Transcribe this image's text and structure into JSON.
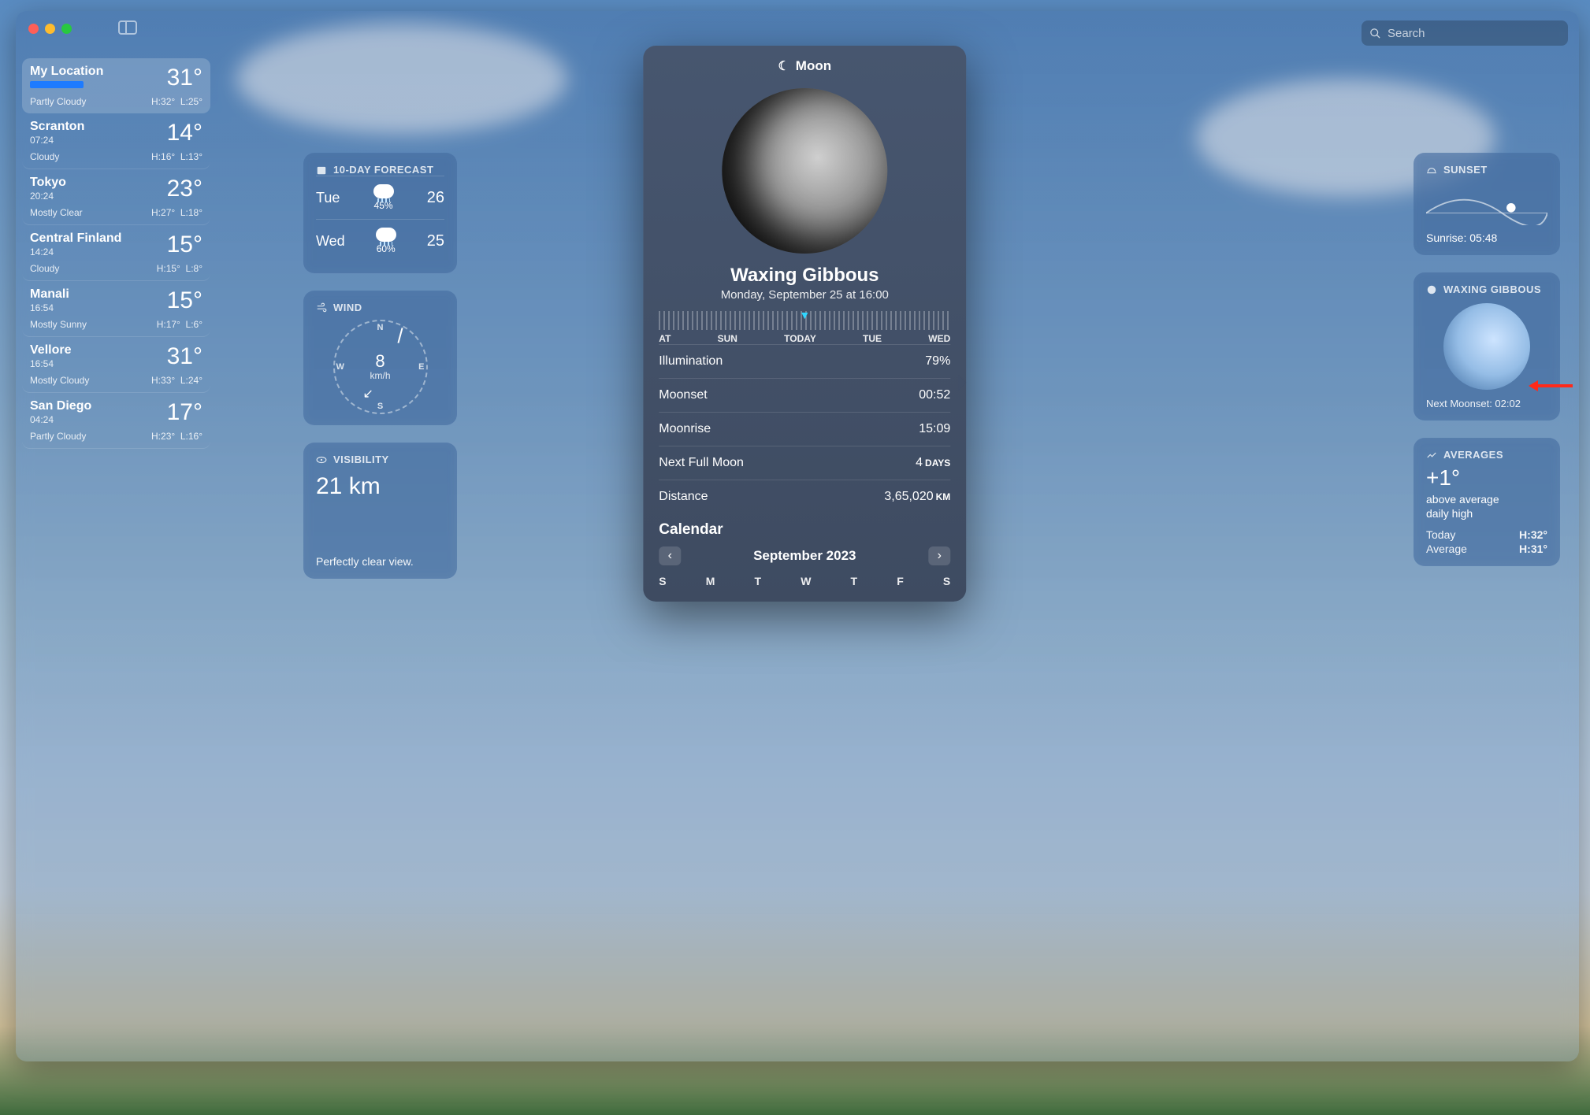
{
  "search": {
    "placeholder": "Search"
  },
  "sidebar": {
    "items": [
      {
        "name": "My Location",
        "time": "",
        "temp": "31°",
        "cond": "Partly Cloudy",
        "hi": "H:32°",
        "lo": "L:25°",
        "selected": true,
        "bluebar": true
      },
      {
        "name": "Scranton",
        "time": "07:24",
        "temp": "14°",
        "cond": "Cloudy",
        "hi": "H:16°",
        "lo": "L:13°"
      },
      {
        "name": "Tokyo",
        "time": "20:24",
        "temp": "23°",
        "cond": "Mostly Clear",
        "hi": "H:27°",
        "lo": "L:18°"
      },
      {
        "name": "Central Finland",
        "time": "14:24",
        "temp": "15°",
        "cond": "Cloudy",
        "hi": "H:15°",
        "lo": "L:8°"
      },
      {
        "name": "Manali",
        "time": "16:54",
        "temp": "15°",
        "cond": "Mostly Sunny",
        "hi": "H:17°",
        "lo": "L:6°"
      },
      {
        "name": "Vellore",
        "time": "16:54",
        "temp": "31°",
        "cond": "Mostly Cloudy",
        "hi": "H:33°",
        "lo": "L:24°"
      },
      {
        "name": "San Diego",
        "time": "04:24",
        "temp": "17°",
        "cond": "Partly Cloudy",
        "hi": "H:23°",
        "lo": "L:16°"
      }
    ]
  },
  "forecast": {
    "title": "10-DAY FORECAST",
    "rows": [
      {
        "day": "Tue",
        "pct": "45%",
        "hi": "26"
      },
      {
        "day": "Wed",
        "pct": "60%",
        "hi": "25"
      }
    ]
  },
  "wind": {
    "title": "WIND",
    "speed": "8",
    "unit": "km/h",
    "dirs": {
      "n": "N",
      "s": "S",
      "e": "E",
      "w": "W"
    }
  },
  "visibility": {
    "title": "VISIBILITY",
    "value": "21 km",
    "desc": "Perfectly clear view."
  },
  "sunset": {
    "title": "SUNSET",
    "sunrise": "Sunrise: 05:48"
  },
  "gibbous_card": {
    "title": "WAXING GIBBOUS",
    "next": "Next Moonset: 02:02"
  },
  "averages": {
    "title": "AVERAGES",
    "delta": "+1°",
    "sub1": "above average",
    "sub2": "daily high",
    "today_label": "Today",
    "today_val": "H:32°",
    "avg_label": "Average",
    "avg_val": "H:31°"
  },
  "moon": {
    "header": "Moon",
    "phase": "Waxing Gibbous",
    "date": "Monday, September 25 at 16:00",
    "timeline": {
      "labels": [
        "AT",
        "SUN",
        "TODAY",
        "TUE",
        "WED"
      ],
      "active_index": 2
    },
    "stats": [
      {
        "label": "Illumination",
        "val": "79%",
        "unit": ""
      },
      {
        "label": "Moonset",
        "val": "00:52",
        "unit": ""
      },
      {
        "label": "Moonrise",
        "val": "15:09",
        "unit": ""
      },
      {
        "label": "Next Full Moon",
        "val": "4",
        "unit": "DAYS"
      },
      {
        "label": "Distance",
        "val": "3,65,020",
        "unit": "KM"
      }
    ],
    "calendar": {
      "title": "Calendar",
      "month": "September 2023",
      "weekdays": [
        "S",
        "M",
        "T",
        "W",
        "T",
        "F",
        "S"
      ]
    }
  }
}
